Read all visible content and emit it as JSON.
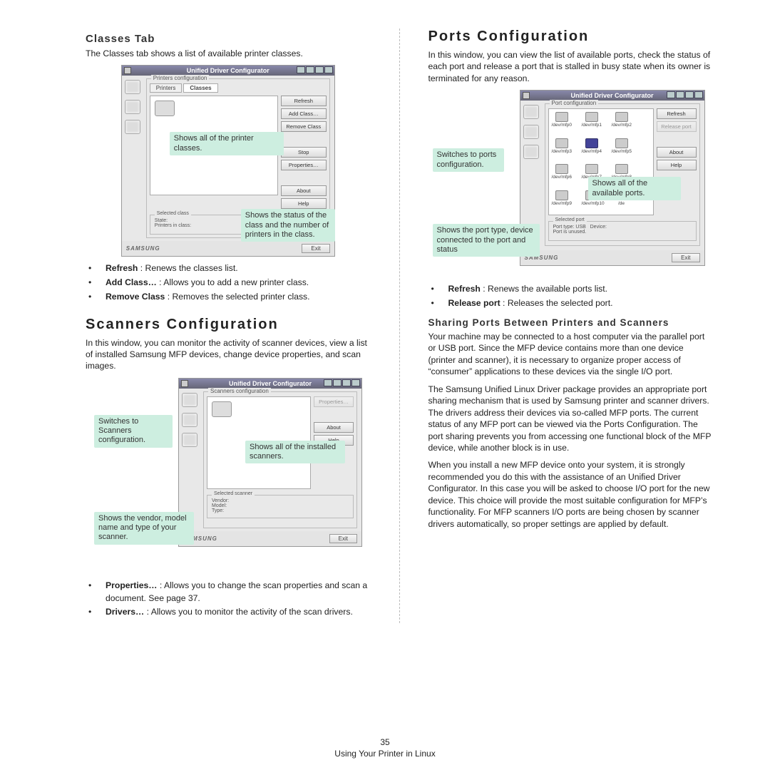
{
  "left": {
    "classes": {
      "heading": "Classes Tab",
      "para": "The Classes tab shows a list of available printer classes.",
      "win_title": "Unified Driver Configurator",
      "group_label": "Printers configuration",
      "tabs": {
        "printers": "Printers",
        "classes": "Classes"
      },
      "buttons": {
        "refresh": "Refresh",
        "add": "Add Class…",
        "remove": "Remove Class",
        "stop": "Stop",
        "props": "Properties…",
        "about": "About",
        "help": "Help"
      },
      "selinfo_label": "Selected class",
      "selinfo_lines": "State:\nPrinters in class:",
      "callout_list": "Shows all of the printer classes.",
      "callout_status": "Shows the status of the class and the number of printers in the class.",
      "bullets": [
        {
          "term": "Refresh",
          "rest": " : Renews the classes list."
        },
        {
          "term": "Add Class…",
          "rest": " : Allows you to add a new printer class."
        },
        {
          "term": "Remove Class",
          "rest": " : Removes the selected printer class."
        }
      ]
    },
    "scanners": {
      "heading": "Scanners Configuration",
      "para": "In this window, you can monitor the activity of scanner devices, view a list of installed Samsung MFP devices, change device properties, and scan images.",
      "win_title": "Unified Driver Configurator",
      "group_label": "Scanners configuration",
      "buttons": {
        "props": "Properties…",
        "about": "About",
        "help": "Help"
      },
      "selinfo_label": "Selected scanner",
      "selinfo_lines": "Vendor:\nModel:\nType:",
      "callout_switch": "Switches to Scanners configuration.",
      "callout_list": "Shows all of the installed scanners.",
      "callout_vendor": "Shows the vendor, model name and type of your scanner.",
      "bullets": [
        {
          "term": "Properties…",
          "rest": " : Allows you to change the scan properties and scan a document. See page 37."
        },
        {
          "term": "Drivers…",
          "rest": " : Allows you to monitor the activity of the scan drivers."
        }
      ]
    }
  },
  "right": {
    "ports": {
      "heading": "Ports Configuration",
      "para": "In this window, you can view the list of available ports, check the status of each port and release a port that is stalled in busy state when its owner is terminated for any reason.",
      "win_title": "Unified Driver Configurator",
      "group_label": "Port configuration",
      "buttons": {
        "refresh": "Refresh",
        "release": "Release port",
        "about": "About",
        "help": "Help"
      },
      "port_labels": [
        "/dev/mfp0",
        "/dev/mfp1",
        "/dev/mfp2",
        "/dev/mfp3",
        "/dev/mfp4",
        "/dev/mfp5",
        "/dev/mfp6",
        "/dev/mfp7",
        "/dev/mfp8",
        "/dev/mfp9",
        "/dev/mfp10",
        "/de"
      ],
      "selinfo_label": "Selected port",
      "selinfo_lines": "Port type: USB   Device:\nPort is unused.",
      "callout_switch": "Switches to ports configuration.",
      "callout_list": "Shows all of the available ports.",
      "callout_type": "Shows the port type, device connected to the port and status",
      "bullets": [
        {
          "term": "Refresh",
          "rest": " : Renews the available ports list."
        },
        {
          "term": "Release port",
          "rest": " : Releases the selected port."
        }
      ]
    },
    "sharing": {
      "heading": "Sharing Ports Between Printers and Scanners",
      "p1": "Your machine may be connected to a host computer via the parallel port or USB port. Since the MFP device contains more than one device (printer and scanner), it is necessary to organize proper access of “consumer” applications to these devices via the single I/O port.",
      "p2": "The Samsung Unified Linux Driver package provides an appropriate port sharing mechanism that is used by Samsung printer and scanner drivers. The drivers address their devices via so-called MFP ports. The current status of any MFP port can be viewed via the Ports Configuration. The port sharing prevents you from accessing one functional block of the MFP device, while another block is in use.",
      "p3": "When you install a new MFP device onto your system, it is strongly recommended you do this with the assistance of an Unified Driver Configurator. In this case you will be asked to choose I/O port for the new device. This choice will provide the most suitable configuration for MFP’s functionality. For MFP scanners I/O ports are being chosen by scanner drivers automatically, so proper settings are applied by default."
    }
  },
  "common": {
    "brand": "SAMSUNG",
    "exit": "Exit"
  },
  "footer": {
    "page_num": "35",
    "page_label": "Using Your Printer in Linux"
  }
}
